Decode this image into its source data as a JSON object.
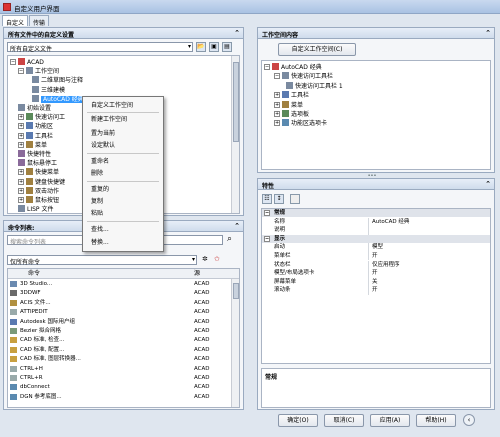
{
  "window": {
    "title": "自定义用户界面"
  },
  "tabs": [
    {
      "label": "自定义"
    },
    {
      "label": "传输"
    }
  ],
  "left_panel": {
    "header": "所有文件中的自定义设置",
    "file_combo": "所有自定义文件",
    "tree": [
      {
        "label": "ACAD",
        "expander": "⊟"
      },
      {
        "label": "工作空间",
        "expander": "⊟"
      },
      {
        "label": "二维草图与注释",
        "expander": ""
      },
      {
        "label": "三维建模",
        "expander": ""
      },
      {
        "label": "AutoCAD 经典",
        "expander": ""
      },
      {
        "label": "初始设置",
        "expander": ""
      },
      {
        "label": "快速访问工",
        "expander": "⊞"
      },
      {
        "label": "功能区",
        "expander": "⊞"
      },
      {
        "label": "工具栏",
        "expander": "⊞"
      },
      {
        "label": "菜单",
        "expander": "⊞"
      },
      {
        "label": "快捷特性",
        "expander": ""
      },
      {
        "label": "鼠标悬停工",
        "expander": ""
      },
      {
        "label": "快捷菜单",
        "expander": "⊞"
      },
      {
        "label": "键盘快捷键",
        "expander": "⊞"
      },
      {
        "label": "双击动作",
        "expander": "⊞"
      },
      {
        "label": "鼠标按钮",
        "expander": "⊞"
      },
      {
        "label": "LISP 文件",
        "expander": ""
      }
    ]
  },
  "context_menu": [
    {
      "label": "自定义工作空间"
    },
    {
      "label": "新建工作空间"
    },
    {
      "label": "置为当前"
    },
    {
      "label": "设定默认"
    },
    {
      "label": "重命名"
    },
    {
      "label": "删除"
    },
    {
      "label": "重复的"
    },
    {
      "label": "复制"
    },
    {
      "label": "粘贴"
    },
    {
      "label": "查找..."
    },
    {
      "label": "替换..."
    }
  ],
  "commands_panel": {
    "header": "命令列表:",
    "search_placeholder": "搜索命令列表",
    "filter_combo": "仅所有命令",
    "col_command": "命令",
    "col_source": "源",
    "rows": [
      {
        "name": "3D Studio...",
        "source": "ACAD"
      },
      {
        "name": "3DDWF",
        "source": "ACAD"
      },
      {
        "name": "ACIS 文件...",
        "source": "ACAD"
      },
      {
        "name": "ATTIPEDIT",
        "source": "ACAD"
      },
      {
        "name": "Autodesk 国际用户组",
        "source": "ACAD"
      },
      {
        "name": "Bezier 拟合网格",
        "source": "ACAD"
      },
      {
        "name": "CAD 标准, 检查...",
        "source": "ACAD"
      },
      {
        "name": "CAD 标准, 配置...",
        "source": "ACAD"
      },
      {
        "name": "CAD 标准, 图层转换器...",
        "source": "ACAD"
      },
      {
        "name": "CTRL+H",
        "source": "ACAD"
      },
      {
        "name": "CTRL+R",
        "source": "ACAD"
      },
      {
        "name": "dbConnect",
        "source": "ACAD"
      },
      {
        "name": "DGN 参考底图...",
        "source": "ACAD"
      }
    ]
  },
  "workspace_panel": {
    "header": "工作空间内容",
    "customize_button": "自定义工作空间(C)",
    "tree": [
      {
        "label": "AutoCAD 经典",
        "expander": "⊟"
      },
      {
        "label": "快速访问工具栏",
        "expander": "⊟"
      },
      {
        "label": "快速访问工具栏 1",
        "expander": ""
      },
      {
        "label": "工具栏",
        "expander": "⊞"
      },
      {
        "label": "菜单",
        "expander": "⊞"
      },
      {
        "label": "选项板",
        "expander": "⊞"
      },
      {
        "label": "功能区选项卡",
        "expander": "⊞"
      }
    ]
  },
  "properties_panel": {
    "header": "特性",
    "rows": [
      {
        "kind": "cat",
        "name": "常规",
        "value": ""
      },
      {
        "kind": "prop",
        "name": "名称",
        "value": "AutoCAD 经典"
      },
      {
        "kind": "prop",
        "name": "说明",
        "value": ""
      },
      {
        "kind": "cat",
        "name": "显示",
        "value": ""
      },
      {
        "kind": "prop",
        "name": "启动",
        "value": "模型"
      },
      {
        "kind": "prop",
        "name": "菜单栏",
        "value": "开"
      },
      {
        "kind": "prop",
        "name": "状态栏",
        "value": "仅应用程序"
      },
      {
        "kind": "prop",
        "name": "模型/布局选项卡",
        "value": "开"
      },
      {
        "kind": "prop",
        "name": "屏幕菜单",
        "value": "关"
      },
      {
        "kind": "prop",
        "name": "滚动条",
        "value": "开"
      }
    ],
    "description_title": "常规"
  },
  "footer": {
    "ok": "确定(O)",
    "cancel": "取消(C)",
    "apply": "应用(A)",
    "help": "帮助(H)"
  },
  "colors": {
    "accent": "#3a78c8",
    "selection": "#3399ff"
  }
}
